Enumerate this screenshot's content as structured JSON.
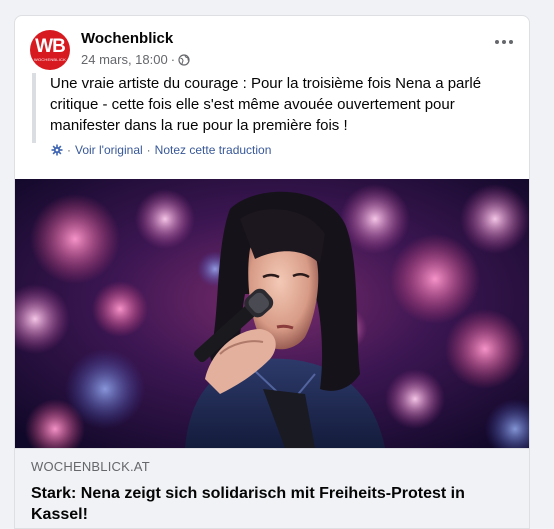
{
  "post": {
    "page_name": "Wochenblick",
    "avatar_text": "WB",
    "avatar_subtext": "WOCHENBLICK",
    "timestamp": "24 mars, 18:00",
    "separator": "·",
    "audience_icon": "globe-icon",
    "more_icon": "more-options-icon",
    "text": "Une vraie artiste du courage : Pour la troisième fois Nena a parlé critique - cette fois elle s'est même avouée ouvertement pour manifester dans la rue pour la première fois !",
    "translation": {
      "icon": "gear-icon",
      "see_original": "Voir l'original",
      "rate": "Notez cette traduction",
      "dot": "·"
    }
  },
  "link_preview": {
    "domain": "WOCHENBLICK.AT",
    "title": "Stark: Nena zeigt sich solidarisch mit Freiheits-Protest in Kassel!"
  },
  "colors": {
    "brand_red": "#d71920",
    "link_blue": "#385898",
    "muted": "#65676b"
  }
}
